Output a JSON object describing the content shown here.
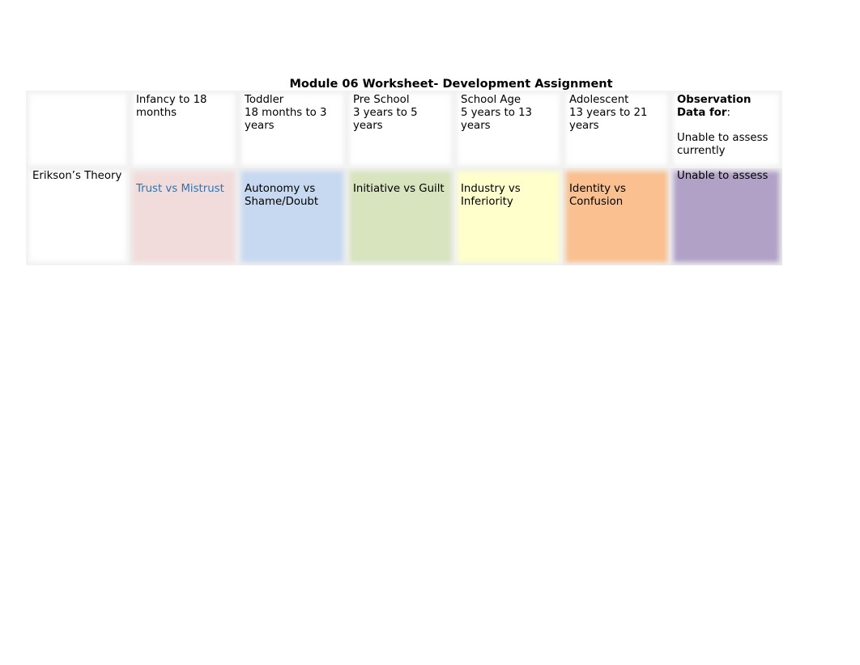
{
  "title": "Module 06 Worksheet- Development Assignment",
  "header": {
    "c1": {
      "l1": "Infancy to 18",
      "l2": "months"
    },
    "c2": {
      "l1": "Toddler",
      "l2": "18 months to 3",
      "l3": "years"
    },
    "c3": {
      "l1": "Pre School",
      "l2": "3 years to 5",
      "l3": "years"
    },
    "c4": {
      "l1": "School Age",
      "l2": "5 years to 13",
      "l3": "years"
    },
    "c5": {
      "l1": "Adolescent",
      "l2": "13 years to 21",
      "l3": "years"
    },
    "c6": {
      "l1": "Observation",
      "l2": "Data for",
      "l2_suffix": ":",
      "l3": "Unable to assess",
      "l4": "currently"
    }
  },
  "erikson": {
    "label": "Erikson’s Theory",
    "c1": {
      "l1": "Trust vs Mistrust",
      "color": "#f2dcdb",
      "text_color": "#2e74b5"
    },
    "c2": {
      "l1": "Autonomy vs",
      "l2": "Shame/Doubt",
      "color": "#c6d9f1"
    },
    "c3": {
      "l1": "Initiative vs Guilt",
      "color": "#d7e4bd"
    },
    "c4": {
      "l1": "Industry vs",
      "l2": "Inferiority",
      "color": "#ffffcc"
    },
    "c5": {
      "l1": "Identity vs",
      "l2": "Confusion",
      "color": "#fac090"
    },
    "c6": {
      "l1": "Unable to assess",
      "color": "#b2a1c7"
    }
  }
}
